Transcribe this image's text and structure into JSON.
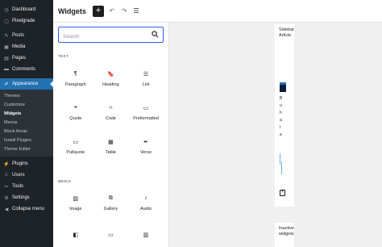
{
  "admin_menu": {
    "top_items": [
      {
        "label": "Dashboard",
        "icon": "dashboard-icon",
        "glyph": "◷"
      },
      {
        "label": "Pixelgrade",
        "icon": "pixelgrade-icon",
        "glyph": "▢"
      }
    ],
    "mid_items": [
      {
        "label": "Posts",
        "icon": "posts-icon",
        "glyph": "✎"
      },
      {
        "label": "Media",
        "icon": "media-icon",
        "glyph": "▣"
      },
      {
        "label": "Pages",
        "icon": "pages-icon",
        "glyph": "▤"
      },
      {
        "label": "Comments",
        "icon": "comments-icon",
        "glyph": "▬"
      }
    ],
    "current_item": {
      "label": "Appearance",
      "icon": "appearance-icon",
      "glyph": "✐"
    },
    "submenu": [
      "Themes",
      "Customize",
      "Widgets",
      "Menus",
      "Block Areas",
      "Install Plugins",
      "Theme Editor"
    ],
    "submenu_active": "Widgets",
    "bottom_items": [
      {
        "label": "Plugins",
        "icon": "plugins-icon",
        "glyph": "⚡"
      },
      {
        "label": "Users",
        "icon": "users-icon",
        "glyph": "☺"
      },
      {
        "label": "Tools",
        "icon": "tools-icon",
        "glyph": "✂"
      },
      {
        "label": "Settings",
        "icon": "settings-icon",
        "glyph": "⚙"
      },
      {
        "label": "Collapse menu",
        "icon": "collapse-icon",
        "glyph": "◀"
      }
    ]
  },
  "header": {
    "title": "Widgets",
    "inserter_glyph": "+",
    "undo_glyph": "↶",
    "redo_glyph": "↷",
    "list_view_glyph": "☰"
  },
  "inserter": {
    "search_placeholder": "Search",
    "categories": [
      {
        "title": "TEXT",
        "blocks": [
          {
            "label": "Paragraph",
            "icon": "paragraph-icon",
            "glyph": "¶"
          },
          {
            "label": "Heading",
            "icon": "heading-icon",
            "glyph": "🔖"
          },
          {
            "label": "List",
            "icon": "list-icon",
            "glyph": "☰"
          },
          {
            "label": "Quote",
            "icon": "quote-icon",
            "glyph": "❝"
          },
          {
            "label": "Code",
            "icon": "code-icon",
            "glyph": "‹›"
          },
          {
            "label": "Preformatted",
            "icon": "preformatted-icon",
            "glyph": "▭"
          },
          {
            "label": "Pullquote",
            "icon": "pullquote-icon",
            "glyph": "▭"
          },
          {
            "label": "Table",
            "icon": "table-icon",
            "glyph": "▦"
          },
          {
            "label": "Verse",
            "icon": "verse-icon",
            "glyph": "✒"
          }
        ]
      },
      {
        "title": "MEDIA",
        "blocks": [
          {
            "label": "Image",
            "icon": "image-icon",
            "glyph": "▨"
          },
          {
            "label": "Gallery",
            "icon": "gallery-icon",
            "glyph": "⧉"
          },
          {
            "label": "Audio",
            "icon": "audio-icon",
            "glyph": "♪"
          },
          {
            "label": "",
            "icon": "cover-icon",
            "glyph": "◧"
          },
          {
            "label": "",
            "icon": "file-icon",
            "glyph": "▭"
          },
          {
            "label": "",
            "icon": "media-text-icon",
            "glyph": "▥"
          }
        ]
      }
    ]
  },
  "canvas": {
    "sidebar_area": {
      "title_line1": "Sidebar",
      "title_line2": "Article",
      "vertical_letters": [
        "B",
        "u",
        "h",
        "a",
        "l",
        "a"
      ],
      "add_glyph": "+"
    },
    "inactive_area": {
      "title_line1": "Inactive",
      "title_line2": "widgets"
    }
  },
  "colors": {
    "admin_bg": "#1d2327",
    "accent": "#2271b1",
    "focus": "#3858e9"
  }
}
